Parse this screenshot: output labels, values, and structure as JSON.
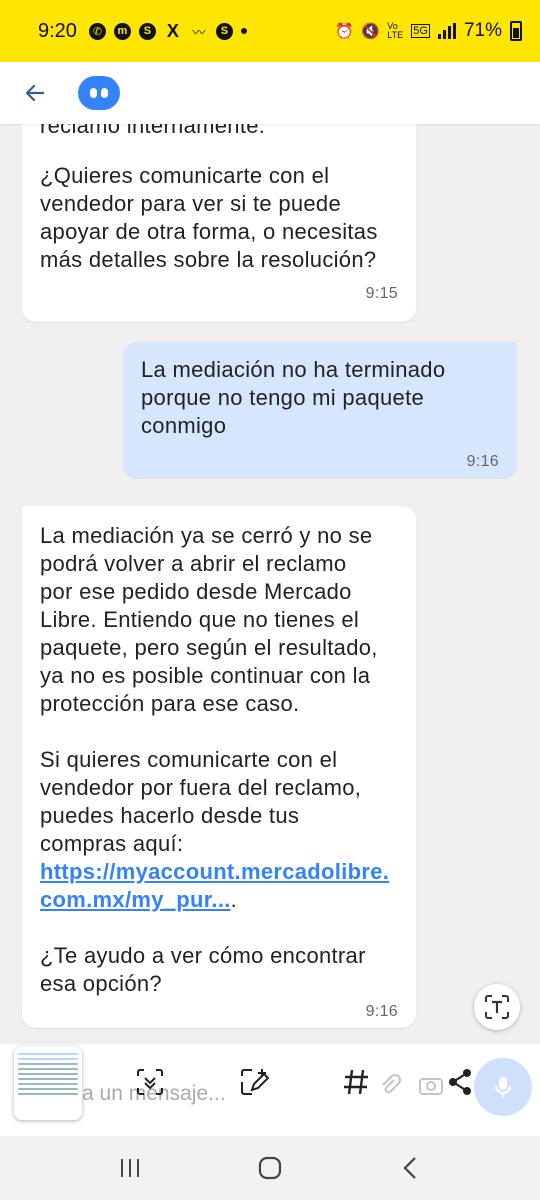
{
  "status_bar": {
    "time": "9:20",
    "battery": "71%",
    "network": "5G",
    "volte": "Vo LTE",
    "accent_color": "#ffe600"
  },
  "header": {
    "back_icon": "arrow-left-icon",
    "avatar_icon": "bot-avatar-icon",
    "brand_color": "#3483fa"
  },
  "messages": [
    {
      "sender": "bot",
      "text_top": "reclamo internamente.",
      "text": "¿Quieres comunicarte con el\nvendedor para ver si te puede\napoyar de otra forma, o necesitas\nmás detalles sobre la resolución?",
      "time": "9:15"
    },
    {
      "sender": "user",
      "text": "La mediación no ha terminado\nporque no tengo mi paquete\nconmigo",
      "time": "9:16"
    },
    {
      "sender": "bot",
      "para1": "La mediación ya se cerró y no se\npodrá volver a abrir el reclamo\npor ese pedido desde Mercado\nLibre. Entiendo que no tienes el\npaquete, pero según el resultado,\nya no es posible continuar con la\nprotección para ese caso.",
      "para2": "Si quieres comunicarte con el\nvendedor por fuera del reclamo,\npuedes hacerlo desde tus\ncompras aquí:",
      "link": "https://myaccount.mercadolibre.\ncom.mx/my_pur...",
      "link_suffix": ".",
      "para3": "¿Te ayudo a ver cómo encontrar\nesa opción?",
      "time": "9:16"
    }
  ],
  "input": {
    "placeholder": "a un mensaje..."
  },
  "toolbar": {
    "icons": [
      "scroll-capture-icon",
      "draw-edit-icon",
      "hashtag-icon",
      "share-icon"
    ]
  },
  "navbar": {
    "icons": [
      "recents-icon",
      "home-icon",
      "back-nav-icon"
    ]
  }
}
